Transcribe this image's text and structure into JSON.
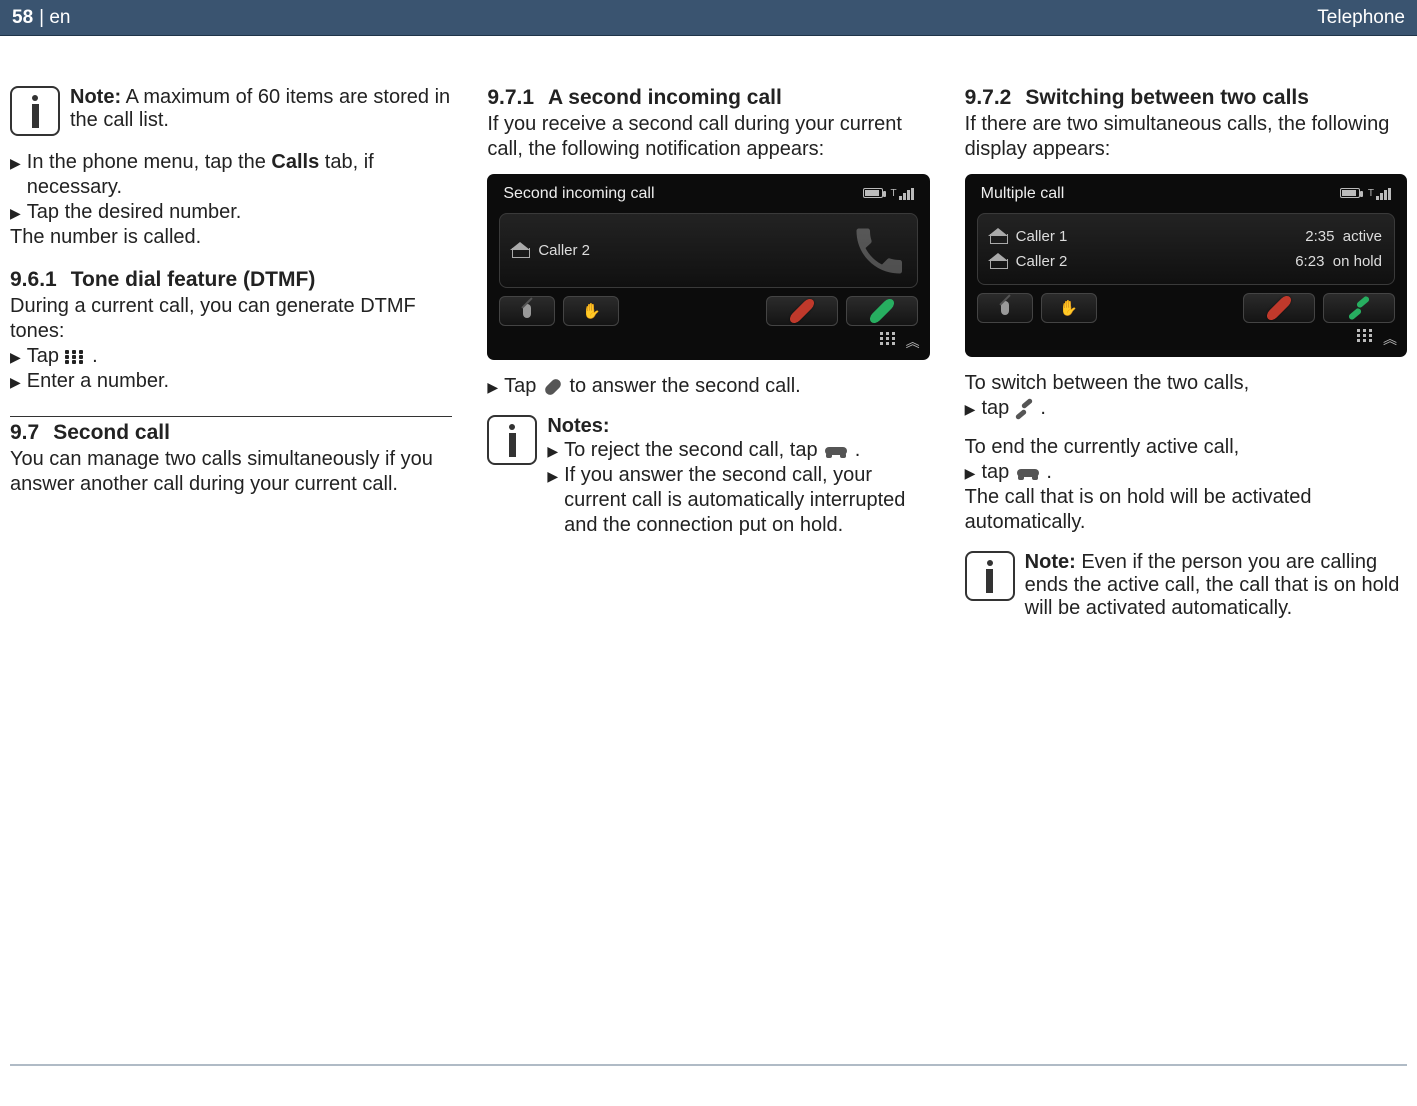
{
  "header": {
    "page": "58",
    "lang_sep": "| en",
    "section": "Telephone"
  },
  "col1": {
    "note1_title": "Note:",
    "note1_body": "A maximum of 60 items are stored in the call list.",
    "step1_pre": "In the phone menu, tap the ",
    "step1_bold": "Calls",
    "step1_post": " tab, if necessary.",
    "step2": "Tap the desired number.",
    "result1": "The number is called.",
    "sec961_num": "9.6.1",
    "sec961_title": "Tone dial feature (DTMF)",
    "sec961_body": "During a current call, you can generate DTMF tones:",
    "sec961_s1": "Tap ",
    "sec961_s1_post": " .",
    "sec961_s2": "Enter a number.",
    "sec97_num": "9.7",
    "sec97_title": "Second call",
    "sec97_body": "You can manage two calls simultaneously if you answer another call during your current call."
  },
  "col2": {
    "sec971_num": "9.7.1",
    "sec971_title": "A second incoming call",
    "sec971_body": "If you receive a second call during your current call, the following notification appears:",
    "screen1": {
      "title": "Second incoming call",
      "caller": "Caller 2"
    },
    "tap_answer_pre": "Tap ",
    "tap_answer_post": " to answer the second call.",
    "notes_title": "Notes:",
    "notes_s1_pre": "To reject the second call, tap ",
    "notes_s1_post": " .",
    "notes_s2": "If you answer the second call, your current call is automatically interrupted and the connection put on hold."
  },
  "col3": {
    "sec972_num": "9.7.2",
    "sec972_title": "Switching between two calls",
    "sec972_body": "If there are two simultaneous calls, the following display appears:",
    "screen2": {
      "title": "Multiple call",
      "row1_name": "Caller 1",
      "row1_time": "2:35",
      "row1_status": "active",
      "row2_name": "Caller 2",
      "row2_time": "6:23",
      "row2_status": "on hold"
    },
    "switch_intro": "To switch between the two calls,",
    "switch_step_pre": "tap ",
    "switch_step_post": " .",
    "end_intro": "To end the currently active call,",
    "end_step_pre": "tap ",
    "end_step_post": " .",
    "end_result": "The call that is on hold will be activated automatically.",
    "note_title": "Note:",
    "note_body": "Even if the person you are calling ends the active call, the call that is on hold will be activated automatically."
  }
}
